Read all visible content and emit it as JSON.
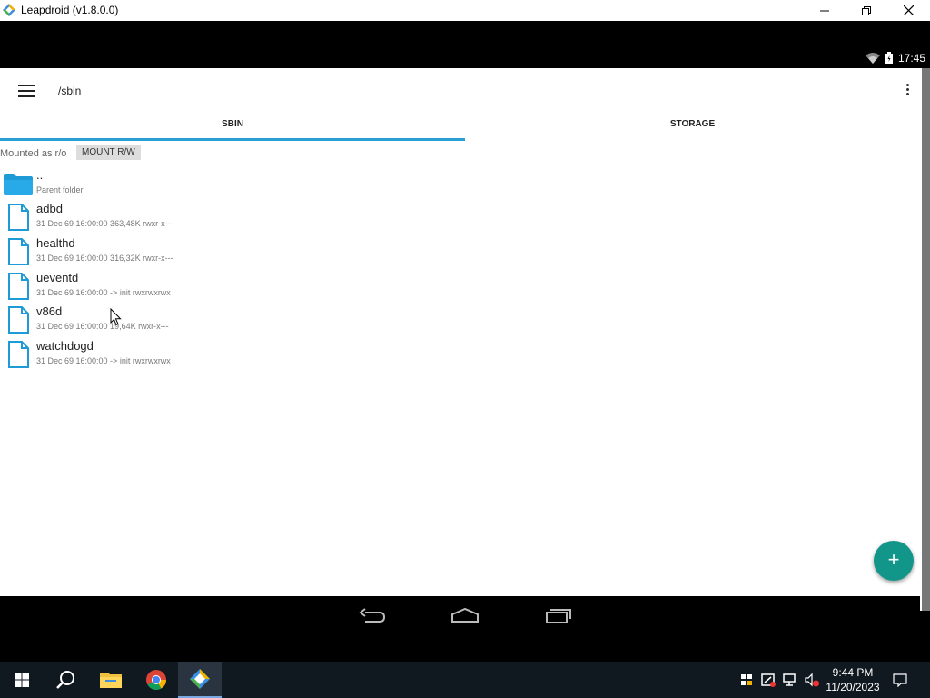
{
  "window": {
    "title": "Leapdroid (v1.8.0.0)",
    "minimize_icon": "minimize-icon",
    "restore_icon": "restore-icon",
    "close_icon": "close-icon"
  },
  "android_status": {
    "time": "17:45",
    "icons": [
      "wifi-icon",
      "battery-icon"
    ]
  },
  "appbar": {
    "path": "/sbin"
  },
  "tabs": [
    {
      "label": "SBIN",
      "selected": true
    },
    {
      "label": "STORAGE",
      "selected": false
    }
  ],
  "mount": {
    "status": "Mounted as r/o",
    "button": "MOUNT R/W"
  },
  "files": [
    {
      "name": "..",
      "meta": "Parent folder",
      "type": "folder"
    },
    {
      "name": "adbd",
      "meta": "31 Dec 69 16:00:00  363,48K  rwxr-x---",
      "type": "file"
    },
    {
      "name": "healthd",
      "meta": "31 Dec 69 16:00:00  316,32K  rwxr-x---",
      "type": "file"
    },
    {
      "name": "ueventd",
      "meta": "31 Dec 69 16:00:00  -> init  rwxrwxrwx",
      "type": "file"
    },
    {
      "name": "v86d",
      "meta": "31 Dec 69 16:00:00  19,64K  rwxr-x---",
      "type": "file"
    },
    {
      "name": "watchdogd",
      "meta": "31 Dec 69 16:00:00  -> init  rwxrwxrwx",
      "type": "file"
    }
  ],
  "fab": {
    "label": "+"
  },
  "taskbar": {
    "apps": [
      "start-icon",
      "search-icon",
      "file-explorer-icon",
      "chrome-icon",
      "leapdroid-icon"
    ],
    "time": "9:44 PM",
    "date": "11/20/2023"
  },
  "colors": {
    "accent": "#2a9fd6",
    "fab": "#13968a",
    "file_icon": "#1e9bd7",
    "folder_icon": "#1e9bd7"
  }
}
